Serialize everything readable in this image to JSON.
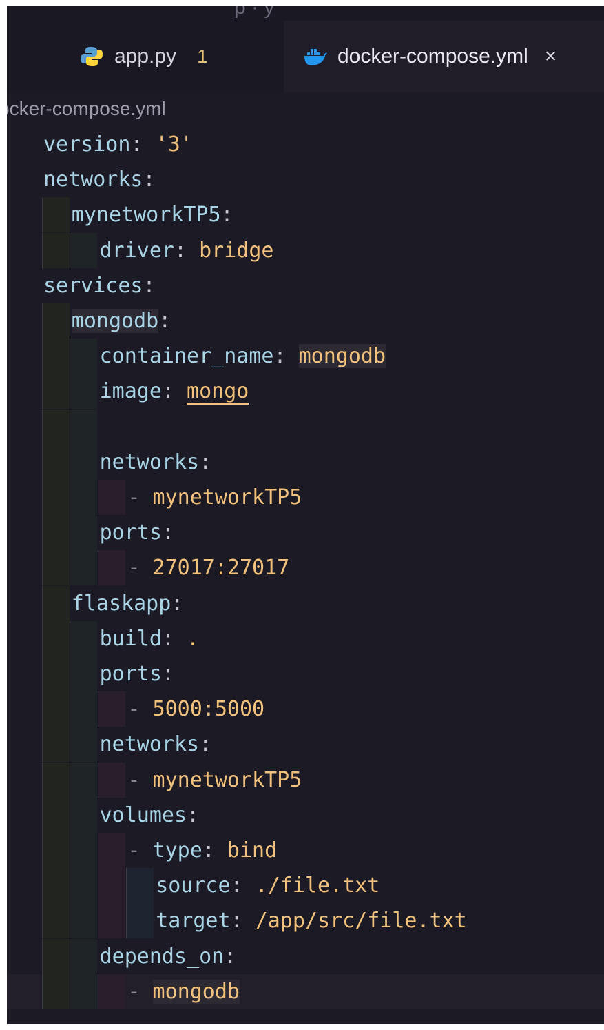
{
  "top_partial_text": "p · y",
  "tabs": [
    {
      "label": "app.py",
      "badge": "1",
      "icon": "python-icon",
      "active": false
    },
    {
      "label": "docker-compose.yml",
      "icon": "docker-icon",
      "active": true,
      "close": "×"
    }
  ],
  "breadcrumb": "ocker-compose.yml",
  "lines": [
    {
      "indent": 0,
      "key": "version",
      "sep": ": ",
      "value": "'3'"
    },
    {
      "indent": 0,
      "key": "networks",
      "sep": ":"
    },
    {
      "indent": 1,
      "key": "mynetworkTP5",
      "sep": ":"
    },
    {
      "indent": 2,
      "key": "driver",
      "sep": ": ",
      "value": "bridge"
    },
    {
      "indent": 0,
      "key": "services",
      "sep": ":"
    },
    {
      "indent": 1,
      "key": "mongodb",
      "sep": ":"
    },
    {
      "indent": 2,
      "key": "container_name",
      "sep": ": ",
      "value": "mongodb"
    },
    {
      "indent": 2,
      "key": "image",
      "sep": ": ",
      "value": "mongo"
    },
    {
      "indent": 2,
      "blank": true
    },
    {
      "indent": 2,
      "key": "networks",
      "sep": ":"
    },
    {
      "indent": 3,
      "dash": "- ",
      "value": "mynetworkTP5"
    },
    {
      "indent": 2,
      "key": "ports",
      "sep": ":"
    },
    {
      "indent": 3,
      "dash": "- ",
      "value": "27017:27017"
    },
    {
      "indent": 1,
      "key": "flaskapp",
      "sep": ":"
    },
    {
      "indent": 2,
      "key": "build",
      "sep": ": ",
      "value": "."
    },
    {
      "indent": 2,
      "key": "ports",
      "sep": ":"
    },
    {
      "indent": 3,
      "dash": "- ",
      "value": "5000:5000"
    },
    {
      "indent": 2,
      "key": "networks",
      "sep": ":"
    },
    {
      "indent": 3,
      "dash": "- ",
      "value": "mynetworkTP5"
    },
    {
      "indent": 2,
      "key": "volumes",
      "sep": ":"
    },
    {
      "indent": 3,
      "dash": "- ",
      "key": "type",
      "sep": ": ",
      "value": "bind"
    },
    {
      "indent": 4,
      "key": "source",
      "sep": ": ",
      "value": "./file.txt"
    },
    {
      "indent": 4,
      "key": "target",
      "sep": ": ",
      "value": "/app/src/file.txt"
    },
    {
      "indent": 2,
      "key": "depends_on",
      "sep": ":"
    },
    {
      "indent": 3,
      "dash": "- ",
      "value": "mongodb"
    }
  ],
  "colors": {
    "key": "#a8d4e6",
    "value": "#f2c27c",
    "background": "#1c1a24"
  }
}
